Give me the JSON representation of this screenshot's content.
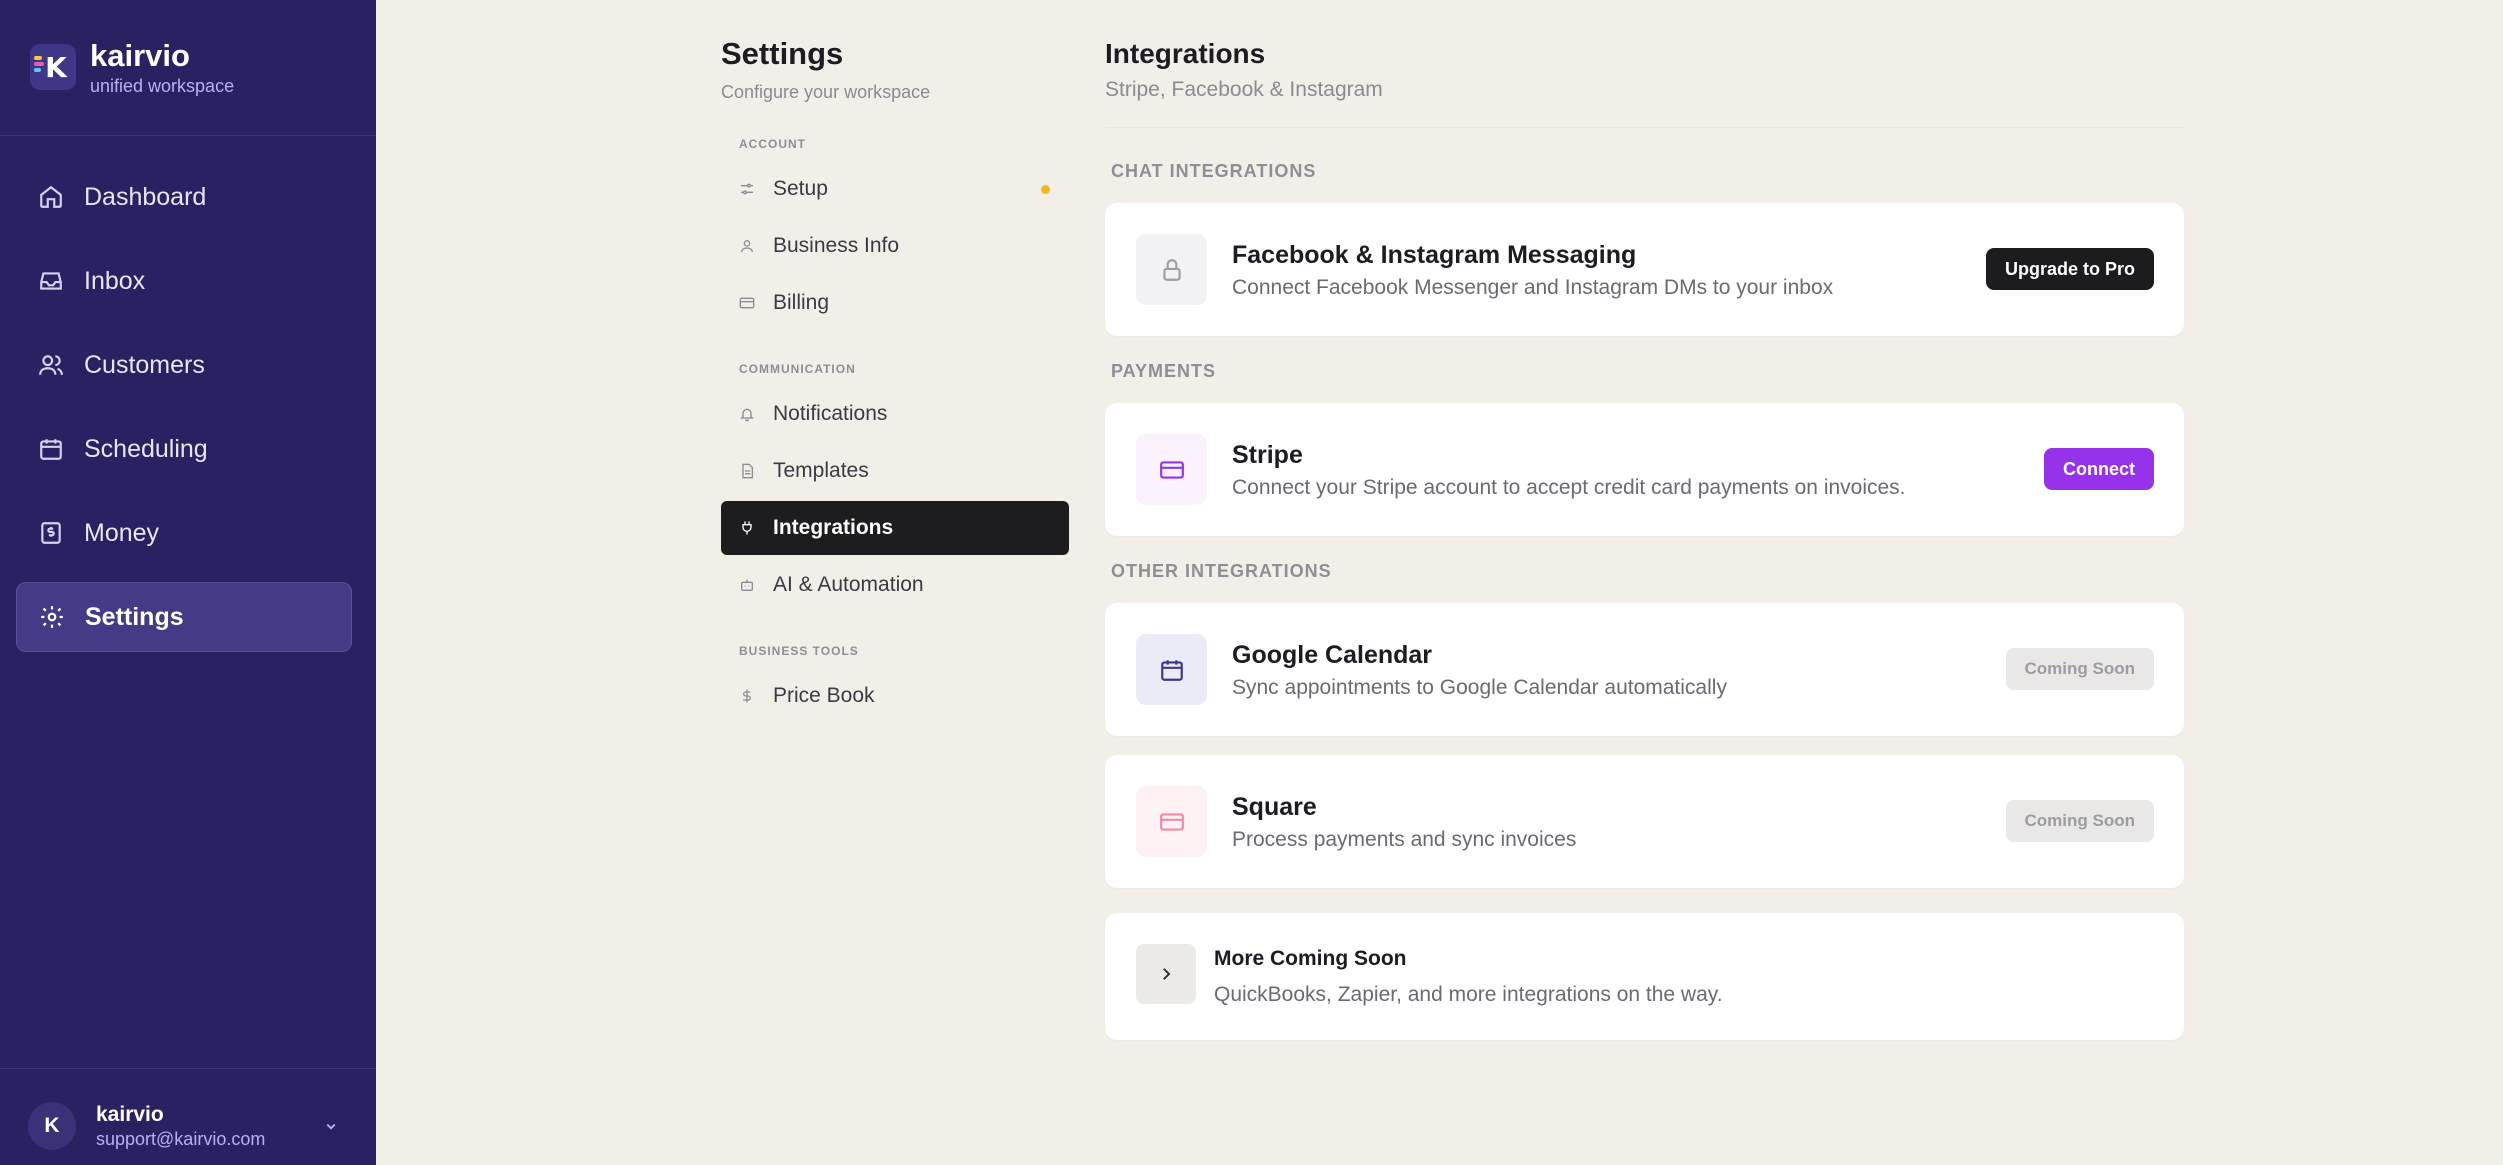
{
  "app": {
    "name": "kairvio",
    "tagline": "unified workspace",
    "logo_letter": "K"
  },
  "sidebar": {
    "items": [
      {
        "label": "Dashboard",
        "icon": "home-icon"
      },
      {
        "label": "Inbox",
        "icon": "inbox-icon"
      },
      {
        "label": "Customers",
        "icon": "users-icon"
      },
      {
        "label": "Scheduling",
        "icon": "calendar-icon"
      },
      {
        "label": "Money",
        "icon": "dollar-receipt-icon"
      },
      {
        "label": "Settings",
        "icon": "gear-icon",
        "active": true
      }
    ],
    "user": {
      "initial": "K",
      "name": "kairvio",
      "email": "support@kairvio.com"
    }
  },
  "settings_nav": {
    "title": "Settings",
    "subtitle": "Configure your workspace",
    "sections": [
      {
        "label": "ACCOUNT",
        "items": [
          "Setup",
          "Business Info",
          "Billing"
        ]
      },
      {
        "label": "COMMUNICATION",
        "items": [
          "Notifications",
          "Templates",
          "Integrations",
          "AI & Automation"
        ]
      },
      {
        "label": "BUSINESS TOOLS",
        "items": [
          "Price Book"
        ]
      }
    ],
    "active": "Integrations"
  },
  "main": {
    "title": "Integrations",
    "subtitle": "Stripe, Facebook & Instagram",
    "sections": {
      "chat": "CHAT INTEGRATIONS",
      "payments": "PAYMENTS",
      "other": "OTHER INTEGRATIONS"
    },
    "cards": {
      "facebook": {
        "title": "Facebook & Instagram Messaging",
        "description": "Connect Facebook Messenger and Instagram DMs to your inbox",
        "button": "Upgrade to Pro",
        "icon": "lock-icon"
      },
      "stripe": {
        "title": "Stripe",
        "description": "Connect your Stripe account to accept credit card payments on invoices.",
        "button": "Connect",
        "icon": "credit-card-icon"
      },
      "google_calendar": {
        "title": "Google Calendar",
        "description": "Sync appointments to Google Calendar automatically",
        "button": "Coming Soon",
        "icon": "calendar-icon"
      },
      "square": {
        "title": "Square",
        "description": "Process payments and sync invoices",
        "button": "Coming Soon",
        "icon": "credit-card-icon"
      },
      "more": {
        "title": "More Coming Soon",
        "description": "QuickBooks, Zapier, and more integrations on the way.",
        "icon": "chevron-right-icon"
      }
    }
  },
  "colors": {
    "sidebar_bg": "#2a2163",
    "page_bg": "#f2efe9",
    "accent_purple": "#9633ea",
    "setup_dot": "#f4b71b"
  }
}
